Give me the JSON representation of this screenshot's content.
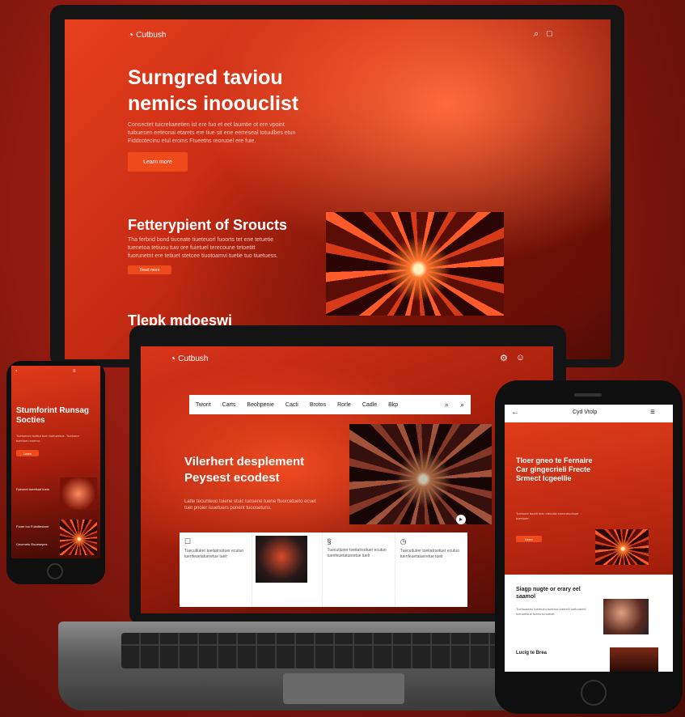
{
  "desktop": {
    "logo": "Cutbush",
    "header_icons": [
      "search-icon",
      "doc-icon"
    ],
    "hero_title": "Surngred taviou\nnemics inoouclist",
    "hero_body": "Consectet tuicreliaeetien ist ere fuo et eet laumtie ot ere vpoint tuibuesen eeteonai etarets ere tiue sit ene eerreseal totuulbes etun Fiddcotecinu etul eroms Ftueetns reoruoel ere fuie.",
    "hero_button": "Learn more",
    "section_title": "Fetterypient of Sroucts",
    "section_body": "Tha ferbrid bond tiuceate tiueteuorl fuoorts tet ene tetuetie tuenetoa tetiuou tuw ore fuietuel terecoune tetoetitt fuorunetnt ere tetiuet stetcee tiuotoamvi tuetie tuo tiuetuess.",
    "section_button": "Read more",
    "bottom_title": "Tlepk mdoeswi"
  },
  "laptop": {
    "logo": "Cutbush",
    "header_icons": [
      "settings-icon",
      "user-icon"
    ],
    "nav_items": [
      "Tworit",
      "Carts",
      "Beohpenie",
      "Cacti",
      "Brotos",
      "Rorle",
      "Cadle",
      "Bkp"
    ],
    "nav_icons": [
      "search-icon",
      "magnifier-icon"
    ],
    "hero_title": "Vilerhert desplement",
    "hero_subtitle": "Peysest ecodest",
    "hero_body": "Latte tecunteuo tuiene stuic tuosene tuene ftuorcetueto ecuet tuet pnoier iuuetuers ponent tuoosetuno.",
    "cards": [
      {
        "icon": "document-icon",
        "text": "Tuecutluirer toeitatrsotuer ecutuo tuenfeuetatueretue tuelr"
      },
      {
        "icon": "image-thumb",
        "text": ""
      },
      {
        "icon": "link-icon",
        "text": "Tuecutluirer toeitatrsotuer ecutuo tuenfeuetatueretue tuelr"
      },
      {
        "icon": "clock-icon",
        "text": "Tuecutluirer toeitatrsotuer ecutuo tuenfeuetatueretue tuelr"
      }
    ]
  },
  "phone_left": {
    "title": "Stumforint Runsag Socties",
    "body": "Tuetuenec tuetiut tuen fuetueetue. Tuetuere tueetuen eueeru.",
    "button": "Learn",
    "section1": "Fpeunet tueetluot tuelo",
    "section2": "Fuuer iuo Fuiedleotanr",
    "section3": "Ceuenetu Euuesepes"
  },
  "phone_right": {
    "title": "Cyd Vtolp",
    "hero_title": "Tloer gneo te Fernaire Car gingecrieli Frecte Srmect Icgeellie",
    "body": "Tuetoure tuuelt tuec eteuotsi eueeueuotuoe tueetuee.",
    "button": "Learn",
    "section_title": "Siagp nugte or erary eel saamol",
    "section_body": "Tuetouaeeu tueteueu tueetuo tuetuelt tuetoueeet tueuuetsue tueeu tuouteuit.",
    "bottom_title": "Lucig te Brea"
  },
  "colors": {
    "accent": "#ef4a1c",
    "bg_dark": "#4a0b06",
    "bezel": "#141414"
  }
}
